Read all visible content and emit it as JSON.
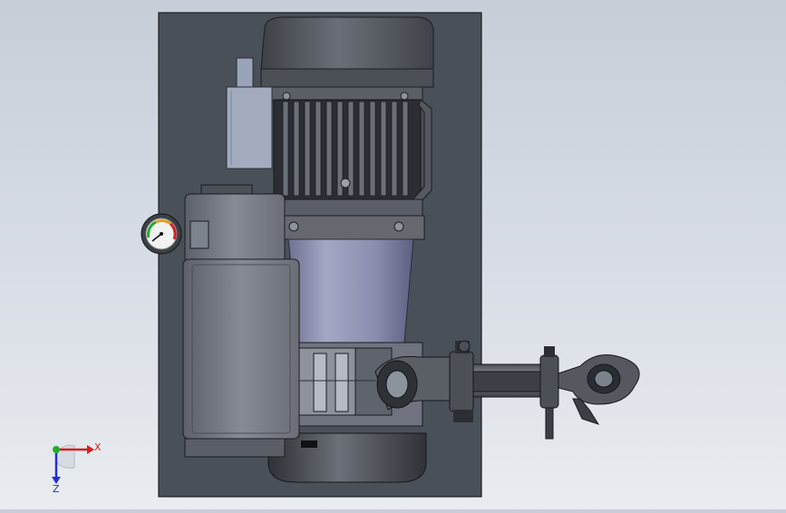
{
  "triad": {
    "x_label": "X",
    "y_label": "Y",
    "z_label": "Z",
    "x_color": "#d42020",
    "y_color": "#1fae2a",
    "z_color": "#2430d0"
  },
  "colors": {
    "backplate": "#4a5058",
    "motor_dark": "#565b62",
    "body_gray": "#7d8390",
    "barrel": "#8f92b3",
    "steel": "#9aa0aa"
  },
  "gauge": {
    "icon": "pressure-gauge-icon"
  }
}
